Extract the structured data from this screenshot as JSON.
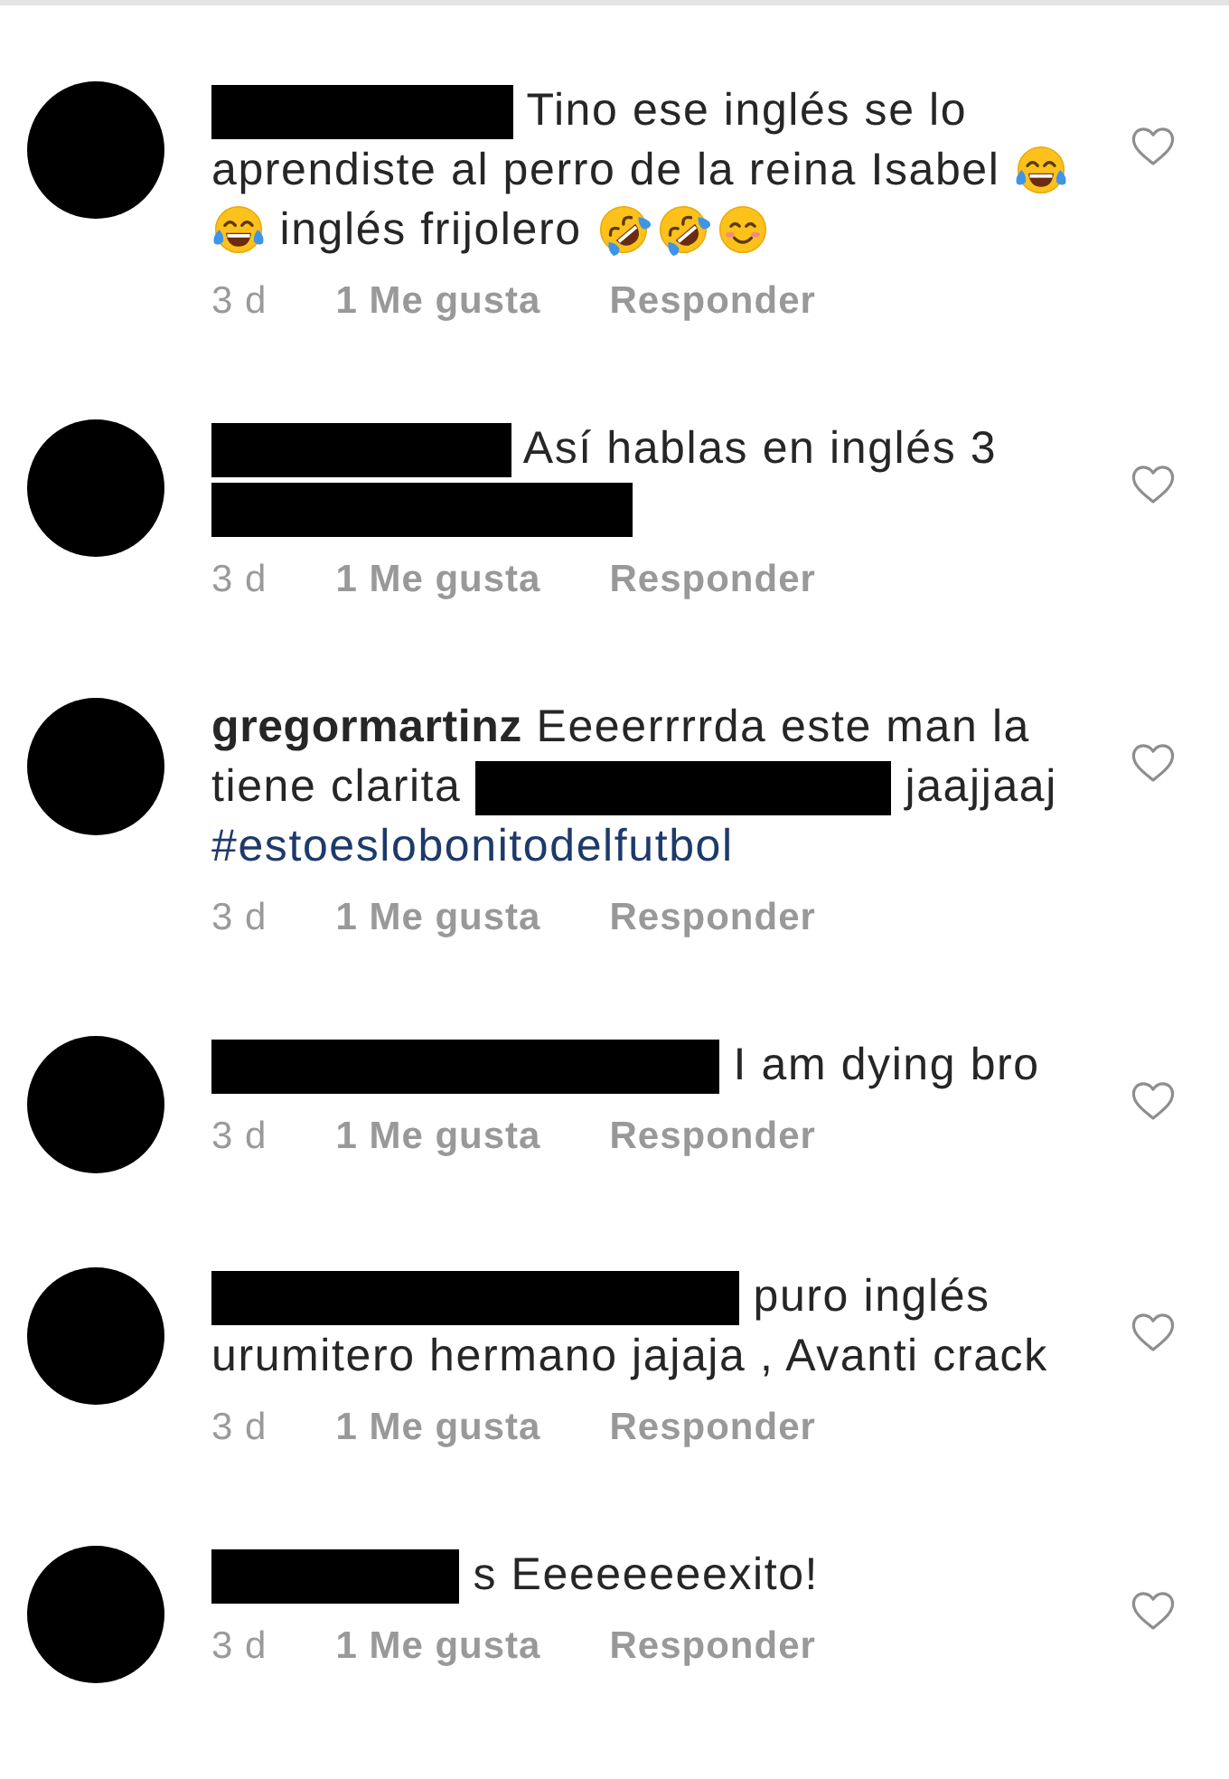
{
  "comments": [
    {
      "lines": [
        [
          {
            "kind": "redaction"
          },
          {
            "kind": "text",
            "text": "Tino ese inglés se lo"
          }
        ],
        [
          {
            "kind": "text",
            "text": "aprendiste al perro de la reina Isabel"
          },
          {
            "kind": "joy"
          }
        ],
        [
          {
            "kind": "joy"
          },
          {
            "kind": "text",
            "text": "inglés frijolero"
          },
          {
            "kind": "rofl"
          },
          {
            "kind": "rofl"
          },
          {
            "kind": "smile"
          }
        ]
      ],
      "time": "3 d",
      "likes": "1 Me gusta",
      "reply": "Responder",
      "liked": false
    },
    {
      "lines": [
        [
          {
            "kind": "redaction"
          },
          {
            "kind": "text",
            "text": "Así hablas en inglés 3"
          }
        ],
        [
          {
            "kind": "redaction"
          }
        ]
      ],
      "time": "3 d",
      "likes": "1 Me gusta",
      "reply": "Responder",
      "liked": false
    },
    {
      "lines": [
        [
          {
            "kind": "username",
            "text": "gregormartinz"
          },
          {
            "kind": "text",
            "text": "Eeeerrrrda este man la"
          }
        ],
        [
          {
            "kind": "text",
            "text": "tiene clarita"
          },
          {
            "kind": "redaction"
          },
          {
            "kind": "text",
            "text": "jaajjaaj"
          }
        ],
        [
          {
            "kind": "hashtag",
            "text": "#estoeslobonitodelfutbol"
          }
        ]
      ],
      "time": "3 d",
      "likes": "1 Me gusta",
      "reply": "Responder",
      "liked": false
    },
    {
      "lines": [
        [
          {
            "kind": "redaction"
          },
          {
            "kind": "text",
            "text": "I am dying bro"
          }
        ]
      ],
      "time": "3 d",
      "likes": "1 Me gusta",
      "reply": "Responder",
      "liked": false
    },
    {
      "lines": [
        [
          {
            "kind": "redaction"
          },
          {
            "kind": "text",
            "text": "puro inglés"
          }
        ],
        [
          {
            "kind": "text",
            "text": "urumitero hermano jajaja , Avanti crack"
          }
        ]
      ],
      "time": "3 d",
      "likes": "1 Me gusta",
      "reply": "Responder",
      "liked": false
    },
    {
      "lines": [
        [
          {
            "kind": "redaction"
          },
          {
            "kind": "text",
            "text": "s Eeeeeeeexito!"
          }
        ]
      ],
      "time": "3 d",
      "likes": "1 Me gusta",
      "reply": "Responder",
      "liked": false
    }
  ]
}
